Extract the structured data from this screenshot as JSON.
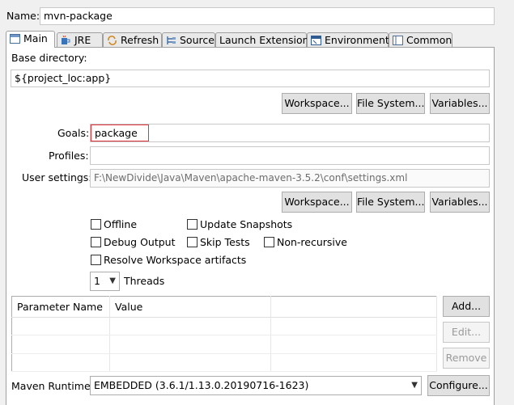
{
  "name_label": "Name:",
  "name_value": "mvn-package",
  "tabs": [
    {
      "label": "Main",
      "icon": "main-tab-icon"
    },
    {
      "label": "JRE",
      "icon": "jre-icon"
    },
    {
      "label": "Refresh",
      "icon": "refresh-icon"
    },
    {
      "label": "Source",
      "icon": "source-icon"
    },
    {
      "label": "Launch Extensions",
      "icon": ""
    },
    {
      "label": "Environment",
      "icon": "environment-icon"
    },
    {
      "label": "Common",
      "icon": "common-icon"
    }
  ],
  "base_directory": {
    "label": "Base directory:",
    "value": "${project_loc:app}",
    "buttons": [
      "Workspace...",
      "File System...",
      "Variables..."
    ]
  },
  "goals": {
    "label": "Goals:",
    "value": "package"
  },
  "profiles": {
    "label": "Profiles:",
    "value": ""
  },
  "user_settings": {
    "label": "User settings:",
    "value": "F:\\NewDivide\\Java\\Maven\\apache-maven-3.5.2\\conf\\settings.xml",
    "buttons": [
      "Workspace...",
      "File System...",
      "Variables..."
    ]
  },
  "options": {
    "offline": "Offline",
    "update_snapshots": "Update Snapshots",
    "debug_output": "Debug Output",
    "skip_tests": "Skip Tests",
    "non_recursive": "Non-recursive",
    "resolve_workspace": "Resolve Workspace artifacts"
  },
  "threads": {
    "value": "1",
    "label": "Threads"
  },
  "params_table": {
    "columns": [
      "Parameter Name",
      "Value"
    ],
    "buttons": {
      "add": "Add...",
      "edit": "Edit...",
      "remove": "Remove"
    }
  },
  "maven_runtime": {
    "label": "Maven Runtime:",
    "value": "EMBEDDED (3.6.1/1.13.0.20190716-1623)",
    "configure": "Configure..."
  },
  "colors": {
    "goals_highlight": "#e0353d"
  }
}
